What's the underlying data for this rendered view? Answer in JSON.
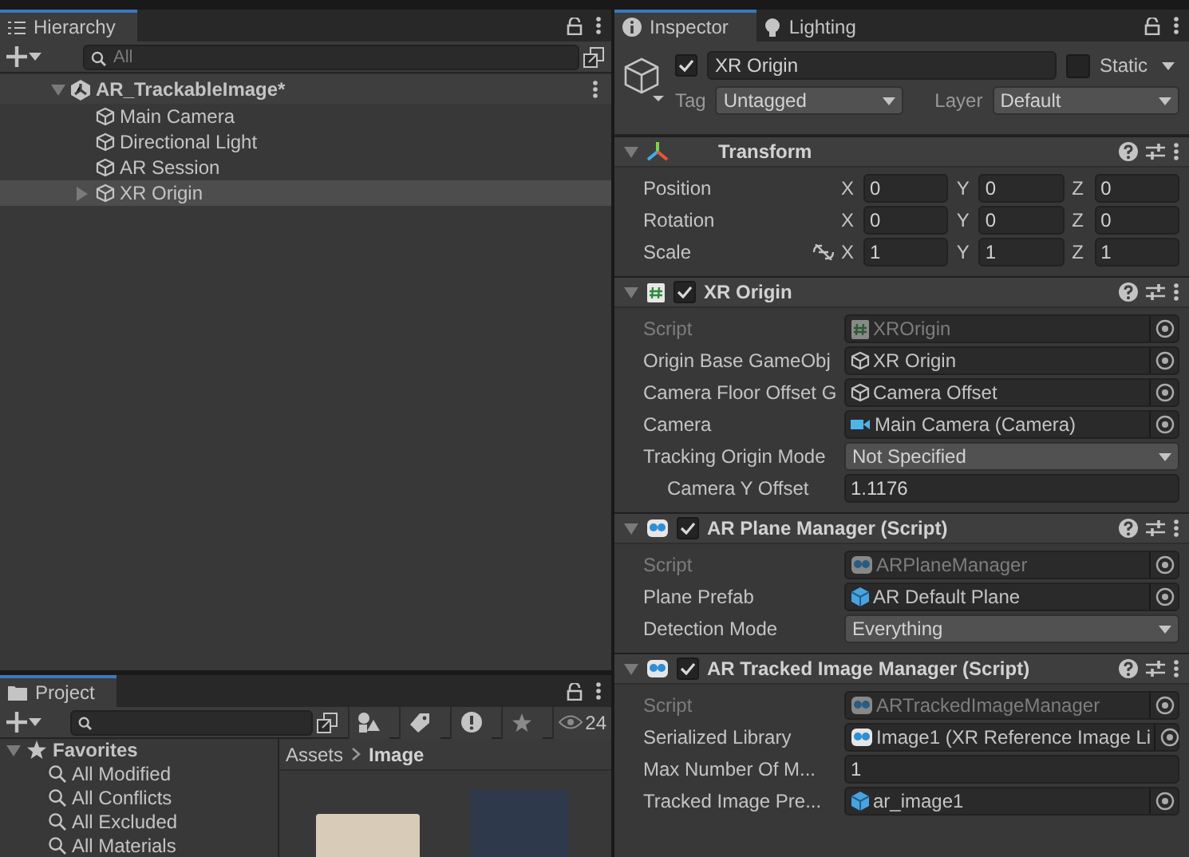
{
  "hierarchy": {
    "tab": "Hierarchy",
    "search": {
      "placeholder": "All"
    },
    "scene": {
      "name": "AR_TrackableImage*",
      "expanded": true,
      "children": [
        {
          "name": "Main Camera",
          "kind": "object",
          "selected": false
        },
        {
          "name": "Directional Light",
          "kind": "object",
          "selected": false
        },
        {
          "name": "AR Session",
          "kind": "object",
          "selected": false
        },
        {
          "name": "XR Origin",
          "kind": "parent",
          "selected": true
        }
      ]
    }
  },
  "project": {
    "tab": "Project",
    "count": "24",
    "favorites": {
      "label": "Favorites",
      "expanded": true,
      "items": [
        "All Modified",
        "All Conflicts",
        "All Excluded",
        "All Materials"
      ]
    },
    "breadcrumb": [
      "Assets",
      "Image"
    ]
  },
  "inspector": {
    "tabs": [
      {
        "label": "Inspector",
        "kind": "info",
        "selected": true
      },
      {
        "label": "Lighting",
        "kind": "bulb",
        "selected": false
      }
    ],
    "object": {
      "active": true,
      "name": "XR Origin",
      "static": false,
      "static_label": "Static",
      "tag_label": "Tag",
      "tag": "Untagged",
      "layer_label": "Layer",
      "layer": "Default"
    },
    "components": [
      {
        "title": "Transform",
        "kind": "transform",
        "expanded": true,
        "rows": [
          {
            "label": "Position",
            "values": [
              {
                "axis": "X",
                "value": "0"
              },
              {
                "axis": "Y",
                "value": "0"
              },
              {
                "axis": "Z",
                "value": "0"
              }
            ]
          },
          {
            "label": "Rotation",
            "values": [
              {
                "axis": "X",
                "value": "0"
              },
              {
                "axis": "Y",
                "value": "0"
              },
              {
                "axis": "Z",
                "value": "0"
              }
            ]
          },
          {
            "label": "Scale",
            "linked": false,
            "values": [
              {
                "axis": "X",
                "value": "1"
              },
              {
                "axis": "Y",
                "value": "1"
              },
              {
                "axis": "Z",
                "value": "1"
              }
            ]
          }
        ]
      },
      {
        "title": "XR Origin",
        "kind": "script",
        "enabled": true,
        "expanded": true,
        "fields": [
          {
            "label": "Script",
            "kind": "object",
            "ref": {
              "kind": "script",
              "value": "XROrigin"
            },
            "disabled": true
          },
          {
            "label": "Origin Base GameObj",
            "kind": "object",
            "ref": {
              "kind": "gameobject",
              "value": "XR Origin"
            },
            "disabled": false
          },
          {
            "label": "Camera Floor Offset G",
            "kind": "object",
            "ref": {
              "kind": "gameobject",
              "value": "Camera Offset"
            },
            "disabled": false
          },
          {
            "label": "Camera",
            "kind": "object",
            "ref": {
              "kind": "camera",
              "value": "Main Camera (Camera)"
            },
            "disabled": false
          },
          {
            "label": "Tracking Origin Mode",
            "kind": "dropdown",
            "value": "Not Specified",
            "disabled": false,
            "children": [
              {
                "label": "Camera Y Offset",
                "kind": "text",
                "value": "1.1176",
                "disabled": false
              }
            ]
          }
        ]
      },
      {
        "title": "AR Plane Manager (Script)",
        "kind": "ar",
        "enabled": true,
        "expanded": true,
        "fields": [
          {
            "label": "Script",
            "kind": "object",
            "ref": {
              "kind": "ar",
              "value": "ARPlaneManager"
            },
            "disabled": true
          },
          {
            "label": "Plane Prefab",
            "kind": "object",
            "ref": {
              "kind": "prefab",
              "value": "AR Default Plane"
            },
            "disabled": false
          },
          {
            "label": "Detection Mode",
            "kind": "dropdown",
            "value": "Everything",
            "disabled": false
          }
        ]
      },
      {
        "title": "AR Tracked Image Manager (Script)",
        "kind": "ar",
        "enabled": true,
        "expanded": true,
        "fields": [
          {
            "label": "Script",
            "kind": "object",
            "ref": {
              "kind": "ar",
              "value": "ARTrackedImageManager"
            },
            "disabled": true
          },
          {
            "label": "Serialized Library",
            "kind": "object",
            "ref": {
              "kind": "ar",
              "value": "Image1 (XR Reference Image Li"
            },
            "disabled": false
          },
          {
            "label": "Max Number Of M...",
            "kind": "text",
            "value": "1",
            "disabled": false
          },
          {
            "label": "Tracked Image Pre...",
            "kind": "object",
            "ref": {
              "kind": "prefab",
              "value": "ar_image1"
            },
            "disabled": false
          }
        ]
      }
    ]
  }
}
